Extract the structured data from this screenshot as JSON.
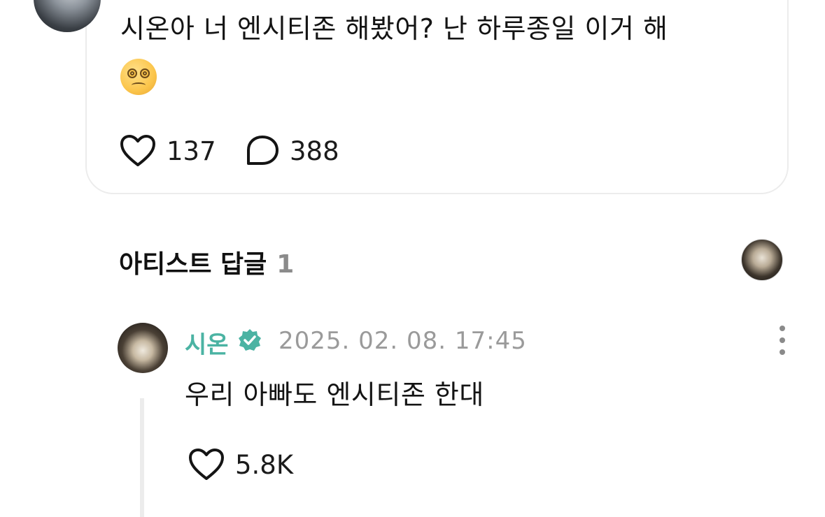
{
  "post": {
    "text_line1": "시온아 너 엔시티존 해봤어? 난 하루종일 이거 해",
    "emoji": "dizzy-face-emoji",
    "likes": "137",
    "comments": "388"
  },
  "artist_replies": {
    "title": "아티스트 답글",
    "count": "1"
  },
  "reply": {
    "author": "시온",
    "date": "2025. 02. 08. 17:45",
    "text": "우리 아빠도 엔시티존 한대",
    "likes": "5.8K"
  },
  "colors": {
    "accent": "#4bb3a3",
    "muted": "#9a9a9a",
    "border": "#ececec"
  }
}
